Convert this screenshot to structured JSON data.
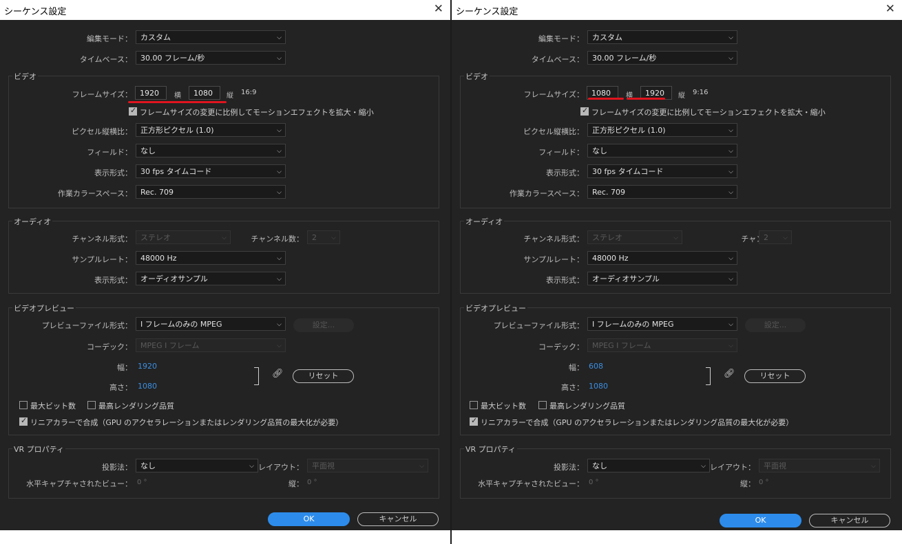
{
  "title": "シーケンス設定",
  "close_glyph": "✕",
  "labels": {
    "edit_mode": "編集モード：",
    "timebase": "タイムベース：",
    "video": "ビデオ",
    "frame_size": "フレームサイズ：",
    "horizontal": "横",
    "vertical": "縦",
    "scale_motion": "フレームサイズの変更に比例してモーションエフェクトを拡大・縮小",
    "pixel_aspect": "ピクセル縦横比：",
    "fields": "フィールド：",
    "display_format": "表示形式：",
    "working_color": "作業カラースペース：",
    "audio": "オーディオ",
    "channel_format": "チャンネル形式：",
    "channel_count": "チャンネル数：",
    "sample_rate": "サンプルレート：",
    "audio_display": "表示形式：",
    "video_preview": "ビデオプレビュー",
    "preview_file_format": "プレビューファイル形式：",
    "codec": "コーデック：",
    "width": "幅：",
    "height": "高さ：",
    "max_bit_depth": "最大ビット数",
    "max_render_quality": "最高レンダリング品質",
    "linear_color": "リニアカラーで合成（GPU のアクセラレーションまたはレンダリング品質の最大化が必要）",
    "vr": "VR プロパティ",
    "projection": "投影法：",
    "layout": "レイアウト：",
    "captured_view": "水平キャプチャされたビュー：",
    "vr_vertical": "縦：",
    "settings_btn": "設定...",
    "reset_btn": "リセット",
    "ok": "OK",
    "cancel": "キャンセル"
  },
  "values": {
    "edit_mode": "カスタム",
    "timebase": "30.00  フレーム/秒",
    "pixel_aspect": "正方形ピクセル (1.0)",
    "fields": "なし",
    "display_format": "30  fps タイムコード",
    "working_color": "Rec. 709",
    "channel_format": "ステレオ",
    "channel_count": "2",
    "sample_rate": "48000 Hz",
    "audio_display": "オーディオサンプル",
    "preview_file_format": "I フレームのみの MPEG",
    "codec": "MPEG I フレーム",
    "projection": "なし",
    "layout": "平面視",
    "captured_view": "0 °",
    "vr_vertical": "0 °"
  },
  "left": {
    "frame_width": "1920",
    "frame_height": "1080",
    "ratio": "16:9",
    "preview_width": "1920",
    "preview_height": "1080"
  },
  "right": {
    "frame_width": "1080",
    "frame_height": "1920",
    "ratio": "9:16",
    "preview_width": "608",
    "preview_height": "1080"
  },
  "icons": {
    "chevron": "chevron-down-icon",
    "link": "link-icon",
    "close": "close-icon"
  },
  "colors": {
    "highlight": "#e0141e",
    "accent": "#2d8ceb",
    "value_blue": "#3b8fe3"
  }
}
